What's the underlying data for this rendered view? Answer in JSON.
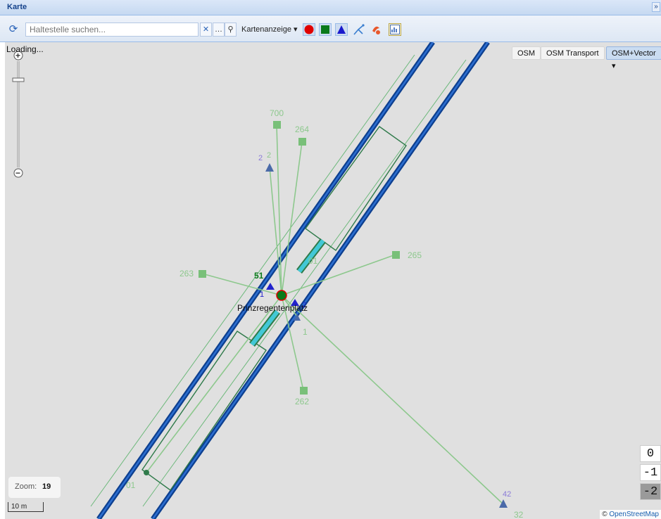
{
  "panel": {
    "title": "Karte",
    "collapse_glyph": "»"
  },
  "toolbar": {
    "refresh_icon": "⟳",
    "search_placeholder": "Haltestelle suchen...",
    "clear_glyph": "✕",
    "more_glyph": "…",
    "search_glyph": "⚲",
    "map_mode_label": "Kartenanzeige ▾",
    "layers": [
      "stop-point-layer",
      "stop-area-layer",
      "platform-layer",
      "route-layer",
      "connection-layer",
      "export-layer"
    ],
    "layer_colors": {
      "stop_point": "#e00000",
      "stop_area": "#0a7a1a",
      "platform": "#1a1acc",
      "route": "#3b7fd0",
      "connection": "#e8582c"
    }
  },
  "map": {
    "loading_text": "Loading...",
    "zoom_plus": "+",
    "zoom_minus": "−",
    "basemaps": [
      "OSM",
      "OSM Transport",
      "OSM+Vector ▾"
    ],
    "active_basemap": "OSM+Vector ▾",
    "zoom_label": "Zoom:",
    "zoom_value": "19",
    "scale_label": "10 m",
    "levels": [
      "0",
      "-1",
      "-2"
    ],
    "active_level": "-2",
    "attribution_prefix": "© ",
    "attribution_link": "OpenStreetMap",
    "station_name": "Prinzregentenplatz",
    "stop_labels": {
      "s700": "700",
      "s264": "264",
      "s2": "2",
      "s2b": "2",
      "s265": "265",
      "s263": "263",
      "s51": "51",
      "s1a": "1",
      "s1b": "1",
      "s2c": "2",
      "s262": "262",
      "s42": "42",
      "s32": "32",
      "s01": "01",
      "s0a": "01"
    },
    "colors": {
      "rail": "#1a57b3",
      "connector": "#8dc88d",
      "stop_fill": "#79c079",
      "platform_outline": "#2f7a4a",
      "platform_fill": "#42c8d6"
    }
  }
}
